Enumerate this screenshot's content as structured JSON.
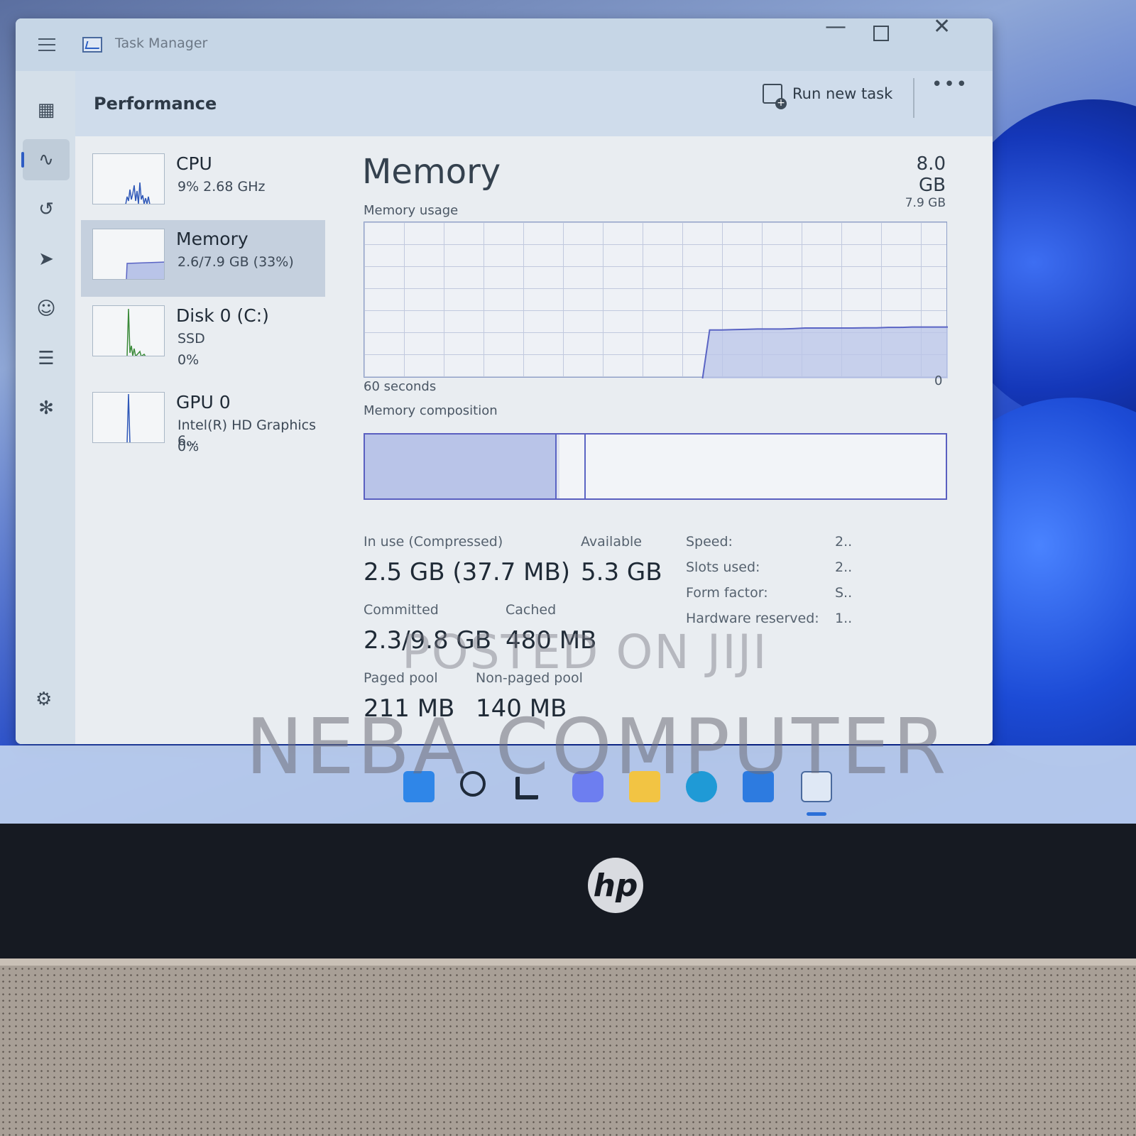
{
  "window": {
    "app_title": "Task Manager",
    "page_title": "Performance",
    "run_new_task_label": "Run new task",
    "more_label": "•••"
  },
  "resources": [
    {
      "name": "CPU",
      "line1": "9%  2.68 GHz",
      "line2": ""
    },
    {
      "name": "Memory",
      "line1": "2.6/7.9 GB (33%)",
      "line2": ""
    },
    {
      "name": "Disk 0 (C:)",
      "line1": "SSD",
      "line2": "0%"
    },
    {
      "name": "GPU 0",
      "line1": "Intel(R) HD Graphics 6...",
      "line2": "0%"
    }
  ],
  "detail": {
    "title": "Memory",
    "total": "8.0 GB",
    "usage_label": "Memory usage",
    "max_value": "7.9 GB",
    "time_label": "60 seconds",
    "min_value": "0",
    "composition_label": "Memory composition"
  },
  "stats": {
    "in_use_label": "In use (Compressed)",
    "in_use_value": "2.5 GB (37.7 MB)",
    "available_label": "Available",
    "available_value": "5.3 GB",
    "committed_label": "Committed",
    "committed_value": "2.3/9.8 GB",
    "cached_label": "Cached",
    "cached_value": "480 MB",
    "paged_label": "Paged pool",
    "paged_value": "211 MB",
    "nonpaged_label": "Non-paged pool",
    "nonpaged_value": "140 MB"
  },
  "properties": [
    {
      "key": "Speed:",
      "value": "2.."
    },
    {
      "key": "Slots used:",
      "value": "2.."
    },
    {
      "key": "Form factor:",
      "value": "S.."
    },
    {
      "key": "Hardware reserved:",
      "value": "1.."
    }
  ],
  "usage_history": {
    "max_gb": 7.9,
    "values_gb": [
      0,
      0,
      0,
      0,
      0,
      0,
      0,
      0,
      0,
      0,
      0,
      0,
      0,
      0,
      0,
      0,
      0,
      0,
      0,
      0,
      0,
      0,
      0,
      0,
      0,
      0,
      0,
      0,
      0,
      2.45,
      2.45,
      2.47,
      2.48,
      2.5,
      2.5,
      2.5,
      2.52,
      2.55,
      2.55,
      2.55,
      2.55,
      2.55,
      2.56,
      2.56,
      2.58,
      2.58,
      2.6,
      2.6,
      2.6,
      2.6
    ]
  },
  "composition": {
    "in_use_fraction": 0.33,
    "modified_fraction": 0.005,
    "standby_fraction": 0.045
  },
  "watermarks": {
    "line1": "POSTED ON JIJI",
    "line2": "NEBA COMPUTER"
  },
  "brand_logo": "hp",
  "colors": {
    "accent": "#2e5cc3",
    "graph_fill": "#b9c4e8",
    "graph_line": "#5a64c4"
  },
  "icons": {
    "rail": [
      "hamburger-icon",
      "processes-icon",
      "performance-icon",
      "app-history-icon",
      "startup-apps-icon",
      "users-icon",
      "details-icon",
      "services-icon",
      "settings-icon"
    ],
    "taskbar": [
      "windows-start-icon",
      "search-icon",
      "task-view-icon",
      "teams-chat-icon",
      "file-explorer-icon",
      "edge-icon",
      "store-icon",
      "task-manager-icon"
    ]
  }
}
